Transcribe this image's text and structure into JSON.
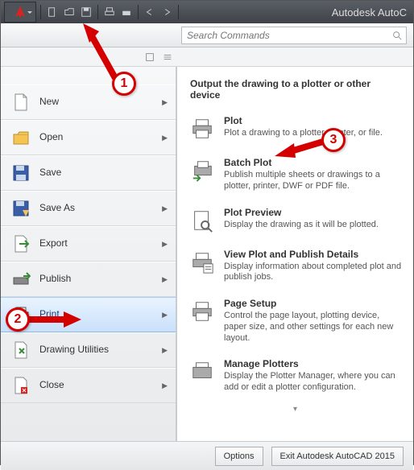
{
  "titlebar": {
    "app_title": "Autodesk AutoC"
  },
  "search": {
    "placeholder": "Search Commands"
  },
  "menu": {
    "items": [
      {
        "label": "New"
      },
      {
        "label": "Open"
      },
      {
        "label": "Save"
      },
      {
        "label": "Save As"
      },
      {
        "label": "Export"
      },
      {
        "label": "Publish"
      },
      {
        "label": "Print"
      },
      {
        "label": "Drawing Utilities"
      },
      {
        "label": "Close"
      }
    ]
  },
  "subpanel": {
    "title": "Output the drawing to a plotter or other device",
    "items": [
      {
        "name": "Plot",
        "desc": "Plot a drawing to a plotter, printer, or file."
      },
      {
        "name": "Batch Plot",
        "desc": "Publish multiple sheets or drawings to a plotter, printer, DWF or PDF file."
      },
      {
        "name": "Plot Preview",
        "desc": "Display the drawing as it will be plotted."
      },
      {
        "name": "View Plot and Publish Details",
        "desc": "Display information about completed plot and publish jobs."
      },
      {
        "name": "Page Setup",
        "desc": "Control the page layout, plotting device, paper size, and other settings for each new layout."
      },
      {
        "name": "Manage Plotters",
        "desc": "Display the Plotter Manager, where you can add or edit a plotter configuration."
      }
    ]
  },
  "footer": {
    "options": "Options",
    "exit": "Exit Autodesk AutoCAD 2015"
  },
  "callouts": {
    "c1": "1",
    "c2": "2",
    "c3": "3"
  }
}
